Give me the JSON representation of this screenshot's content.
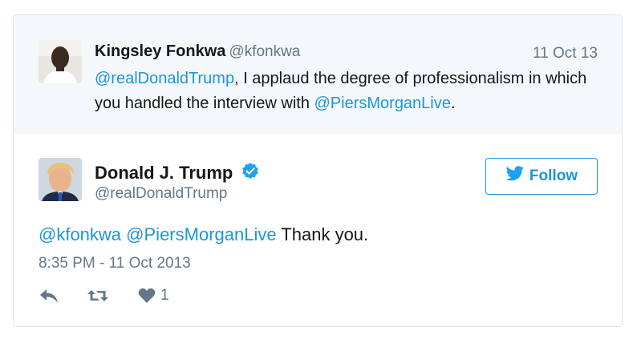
{
  "reply": {
    "name": "Kingsley Fonkwa",
    "handle": "@kfonkwa",
    "date": "11 Oct 13",
    "mention": "@realDonaldTrump",
    "text_part1": ", I applaud the degree of professionalism in which you handled the interview with ",
    "mention2": "@PiersMorganLive",
    "text_end": "."
  },
  "tweet": {
    "name": "Donald J. Trump",
    "handle": "@realDonaldTrump",
    "mention1": "@kfonkwa",
    "mention2": "@PiersMorganLive",
    "text": " Thank you.",
    "timestamp": "8:35 PM - 11 Oct 2013",
    "like_count": "1"
  },
  "follow_button": {
    "label": "Follow"
  },
  "colors": {
    "link": "#1b95e0",
    "muted": "#657786",
    "reply_bg": "#f5f8fa"
  },
  "icons": [
    "reply-icon",
    "retweet-icon",
    "heart-icon",
    "twitter-bird-icon",
    "verified-badge-icon"
  ]
}
